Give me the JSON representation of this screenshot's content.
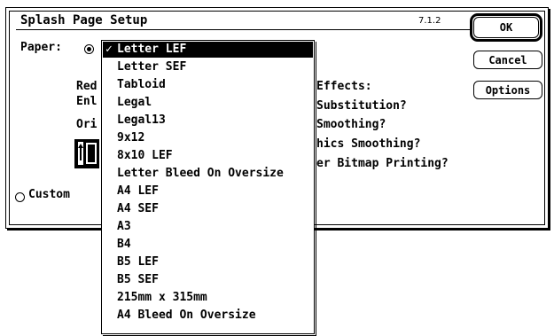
{
  "dialog": {
    "title": "Splash Page Setup",
    "version": "7.1.2",
    "buttons": {
      "ok": "OK",
      "cancel": "Cancel",
      "options": "Options"
    },
    "paper_label": "Paper:",
    "custom_label": "Custom",
    "partial_labels": {
      "reduce": "Red",
      "enlarge": "Enl",
      "orientation": "Ori"
    },
    "printer_effects": {
      "heading": "Effects:",
      "items": [
        "Substitution?",
        "Smoothing?",
        "hics Smoothing?",
        "er Bitmap Printing?"
      ]
    }
  },
  "paper_menu": {
    "selected_index": 0,
    "check_mark": "✓",
    "items": [
      "Letter LEF",
      "Letter SEF",
      "Tabloid",
      "Legal",
      "Legal13",
      "9x12",
      "8x10 LEF",
      "Letter Bleed On Oversize",
      "A4 LEF",
      "A4 SEF",
      "A3",
      "B4",
      "B5 LEF",
      "B5 SEF",
      "215mm x 315mm",
      "A4 Bleed On Oversize"
    ]
  }
}
